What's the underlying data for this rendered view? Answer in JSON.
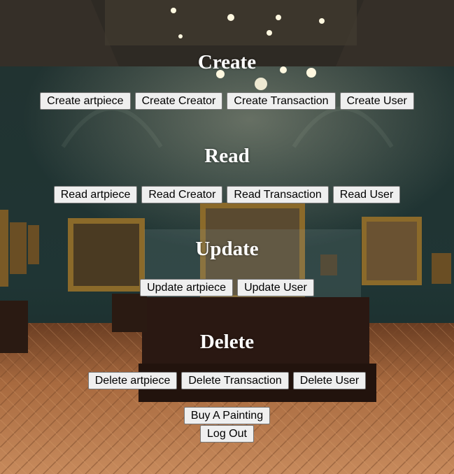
{
  "sections": {
    "create": {
      "heading": "Create",
      "buttons": [
        "Create artpiece",
        "Create Creator",
        "Create Transaction",
        "Create User"
      ]
    },
    "read": {
      "heading": "Read",
      "buttons": [
        "Read artpiece",
        "Read Creator",
        "Read Transaction",
        "Read User"
      ]
    },
    "update": {
      "heading": "Update",
      "buttons": [
        "Update artpiece",
        "Update User"
      ]
    },
    "delete": {
      "heading": "Delete",
      "buttons": [
        "Delete artpiece",
        "Delete Transaction",
        "Delete User"
      ]
    }
  },
  "actions": {
    "buy": "Buy A Painting",
    "logout": "Log Out"
  }
}
